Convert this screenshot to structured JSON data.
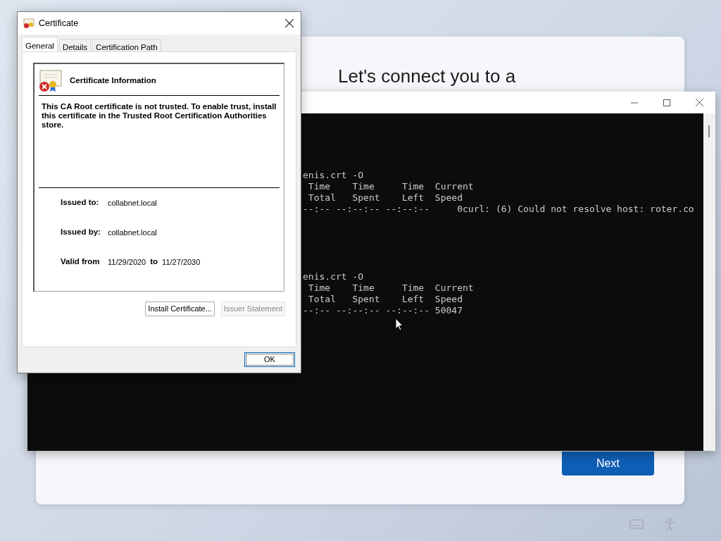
{
  "setup_page": {
    "heading": "Let's connect you to a",
    "next_button": "Next"
  },
  "console_window": {
    "blocks": [
      {
        "lines": [
          "enis.crt -O",
          " Time    Time     Time  Current",
          " Total   Spent    Left  Speed",
          "--:-- --:--:-- --:--:--     0curl: (6) Could not resolve host: roter.co"
        ]
      },
      {
        "lines": [
          "enis.crt -O",
          " Time    Time     Time  Current",
          " Total   Spent    Left  Speed",
          "--:-- --:--:-- --:--:-- 50047"
        ]
      }
    ]
  },
  "certificate_dialog": {
    "title": "Certificate",
    "tabs": [
      {
        "label": "General",
        "selected": true
      },
      {
        "label": "Details",
        "selected": false
      },
      {
        "label": "Certification Path",
        "selected": false
      }
    ],
    "info_title": "Certificate Information",
    "message": "This CA Root certificate is not trusted. To enable trust, install this certificate in the Trusted Root Certification Authorities store.",
    "fields": [
      {
        "label": "Issued to:",
        "value": "collabnet.local"
      },
      {
        "label": "Issued by:",
        "value": "collabnet.local"
      }
    ],
    "validity": {
      "from_label": "Valid from",
      "from": "11/29/2020",
      "to_label": "to",
      "to": "11/27/2030"
    },
    "buttons": [
      {
        "label": "Install Certificate...",
        "disabled": false
      },
      {
        "label": "Issuer Statement",
        "disabled": true
      }
    ],
    "ok_button": "OK"
  }
}
